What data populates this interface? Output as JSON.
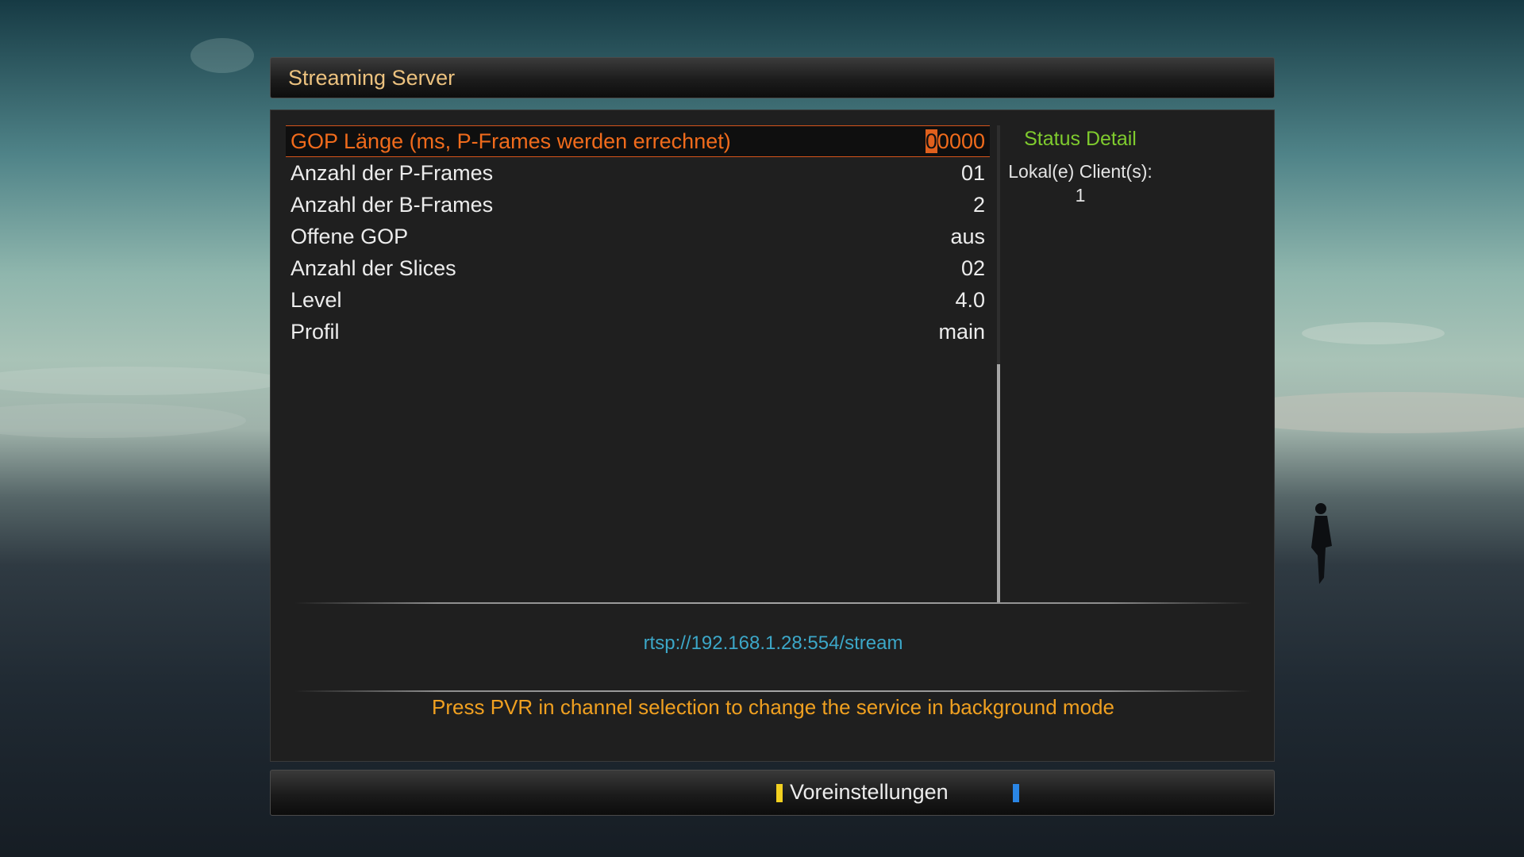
{
  "window": {
    "title": "Streaming Server"
  },
  "settings": [
    {
      "label": "GOP Länge (ms, P-Frames werden errechnet)",
      "value_cursor": "0",
      "value_rest": "0000",
      "selected": true
    },
    {
      "label": "Anzahl der P-Frames",
      "value": "01"
    },
    {
      "label": "Anzahl der B-Frames",
      "value": "2"
    },
    {
      "label": "Offene GOP",
      "value": "aus"
    },
    {
      "label": "Anzahl der Slices",
      "value": "02"
    },
    {
      "label": "Level",
      "value": "4.0"
    },
    {
      "label": "Profil",
      "value": "main"
    }
  ],
  "status": {
    "title": "Status Detail",
    "label": "Lokal(e) Client(s):",
    "value": "1"
  },
  "stream_url": "rtsp://192.168.1.28:554/stream",
  "hint": "Press PVR in channel selection to change the service in background mode",
  "footer": {
    "yellow_label": "Voreinstellungen",
    "blue_label": ""
  },
  "colors": {
    "selected_text": "#f06b1c",
    "status_title": "#7fcb2e",
    "url": "#3ca7c8",
    "hint": "#f0a020",
    "title": "#ecc27f",
    "key_yellow": "#f2d020",
    "key_blue": "#2a86e6"
  }
}
